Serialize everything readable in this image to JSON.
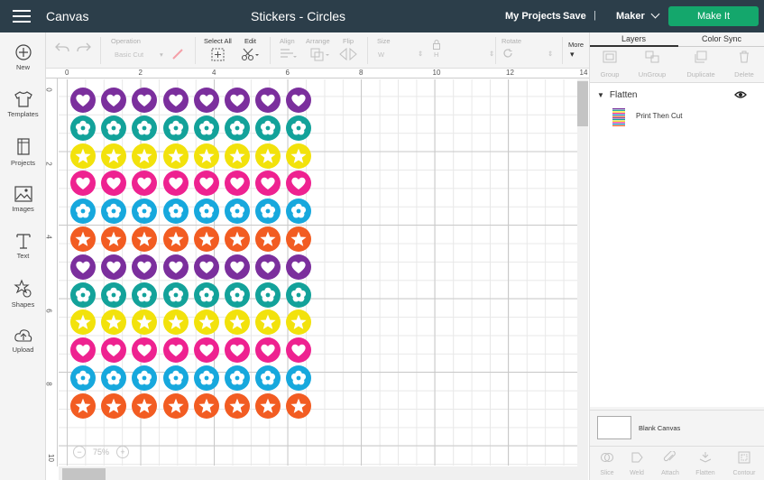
{
  "header": {
    "app_title": "Canvas",
    "project_title": "Stickers - Circles",
    "my_projects": "My Projects",
    "save": "Save",
    "separator": "|",
    "machine": "Maker",
    "make_it": "Make It"
  },
  "sidebar": {
    "items": [
      {
        "label": "New",
        "icon": "plus-circle-icon"
      },
      {
        "label": "Templates",
        "icon": "shirt-icon"
      },
      {
        "label": "Projects",
        "icon": "projects-icon"
      },
      {
        "label": "Images",
        "icon": "image-icon"
      },
      {
        "label": "Text",
        "icon": "text-icon"
      },
      {
        "label": "Shapes",
        "icon": "shapes-icon"
      },
      {
        "label": "Upload",
        "icon": "upload-cloud-icon"
      }
    ]
  },
  "toolbar": {
    "operation_label": "Operation",
    "operation_value": "Basic Cut",
    "select_all": "Select All",
    "edit": "Edit",
    "align": "Align",
    "arrange": "Arrange",
    "flip": "Flip",
    "size": "Size",
    "size_w": "W",
    "size_h": "H",
    "rotate": "Rotate",
    "more": "More"
  },
  "ruler": {
    "top": [
      "0",
      "2",
      "4",
      "6",
      "8",
      "10",
      "12",
      "14"
    ],
    "left": [
      "0",
      "2",
      "4",
      "6",
      "8",
      "10"
    ]
  },
  "zoom": {
    "minus": "−",
    "value": "75%",
    "plus": "+"
  },
  "stickers": {
    "columns": 8,
    "rows": [
      {
        "motif": "heart",
        "color": "#7b2f9d"
      },
      {
        "motif": "flower",
        "color": "#13a29a"
      },
      {
        "motif": "star",
        "color": "#f2e20c"
      },
      {
        "motif": "heart",
        "color": "#ee2290"
      },
      {
        "motif": "flower",
        "color": "#17a8dd"
      },
      {
        "motif": "star",
        "color": "#f25c22"
      },
      {
        "motif": "heart",
        "color": "#7b2f9d"
      },
      {
        "motif": "flower",
        "color": "#13a29a"
      },
      {
        "motif": "star",
        "color": "#f2e20c"
      },
      {
        "motif": "heart",
        "color": "#ee2290"
      },
      {
        "motif": "flower",
        "color": "#17a8dd"
      },
      {
        "motif": "star",
        "color": "#f25c22"
      }
    ]
  },
  "panel": {
    "tabs": [
      "Layers",
      "Color Sync"
    ],
    "layer_tools": [
      "Group",
      "UnGroup",
      "Duplicate",
      "Delete"
    ],
    "layer_group": "Flatten",
    "layer_item": "Print Then Cut",
    "canvas_label": "Blank Canvas",
    "bottom_tools": [
      "Slice",
      "Weld",
      "Attach",
      "Flatten",
      "Contour"
    ]
  },
  "colors": {
    "header_bg": "#2c3e4a",
    "make_it": "#14a76c"
  }
}
